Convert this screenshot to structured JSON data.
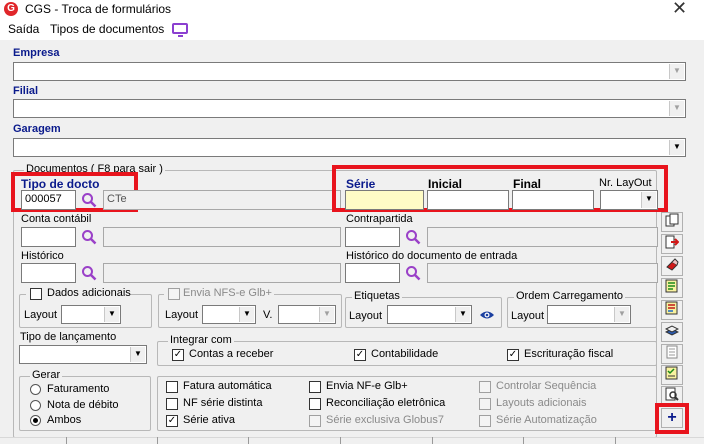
{
  "window": {
    "title": "CGS - Troca de formulários",
    "close": "✕"
  },
  "menu": {
    "saida": "Saída",
    "tipos": "Tipos de documentos"
  },
  "labels": {
    "empresa": "Empresa",
    "filial": "Filial",
    "garagem": "Garagem",
    "documentos": "Documentos ( F8 para sair )",
    "tipo_docto": "Tipo de docto",
    "serie": "Série",
    "inicial": "Inicial",
    "final": "Final",
    "nr_layout": "Nr. LayOut",
    "conta_contabil": "Conta contábil",
    "contrapartida": "Contrapartida",
    "historico": "Histórico",
    "historico_entrada": "Histórico do documento de entrada",
    "dados_adicionais": "Dados adicionais",
    "envia_nfs": "Envia NFS-e Glb+",
    "etiquetas": "Etiquetas",
    "ordem_carregamento": "Ordem Carregamento",
    "layout": "Layout",
    "v": "V.",
    "tipo_lancamento": "Tipo de lançamento",
    "integrar_com": "Integrar com",
    "gerar": "Gerar"
  },
  "fields": {
    "tipo_docto_code": "000057",
    "tipo_docto_desc": "CTe"
  },
  "integrar": {
    "contas_receber": "Contas a receber",
    "contabilidade": "Contabilidade",
    "escrituracao": "Escrituração fiscal"
  },
  "gerar": {
    "faturamento": "Faturamento",
    "nota_debito": "Nota de débito",
    "ambos": "Ambos"
  },
  "options": {
    "fatura_automatica": "Fatura automática",
    "nf_serie_distinta": "NF série distinta",
    "serie_ativa": "Série ativa",
    "envia_nfe": "Envia NF-e Glb+",
    "reconciliacao": "Reconciliação eletrônica",
    "serie_exclusiva": "Série exclusiva Globus7",
    "controlar_sequencia": "Controlar Sequência",
    "layouts_adicionais": "Layouts adicionais",
    "serie_automatizacao": "Série Automatização"
  },
  "toolbar": {
    "add": "+"
  },
  "colors": {
    "highlight": "#e8141d",
    "label_blue": "#0a1a8c",
    "serie_bg": "#fffcc6",
    "icon_purple": "#8b3fd0"
  }
}
